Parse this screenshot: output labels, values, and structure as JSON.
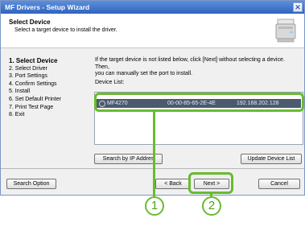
{
  "window": {
    "title": "MF Drivers - Setup Wizard",
    "close_glyph": "✕"
  },
  "header": {
    "title": "Select Device",
    "subtitle": "Select a target device to install the driver."
  },
  "steps": [
    {
      "label": "1.  Select Device",
      "active": true
    },
    {
      "label": "2.  Select Driver"
    },
    {
      "label": "3.  Port Settings"
    },
    {
      "label": "4.  Confirm Settings"
    },
    {
      "label": "5.  Install"
    },
    {
      "label": "6.  Set Default Printer"
    },
    {
      "label": "7.  Print Test Page"
    },
    {
      "label": "8.  Exit"
    }
  ],
  "main": {
    "note_line1": "If the target device is not listed below, click [Next] without selecting a device. Then,",
    "note_line2": "you can manually set the port to install.",
    "device_list_label": "Device List:",
    "devices": [
      {
        "name": "MF4270",
        "mac": "00-00-85-65-2E-4E",
        "ip": "192.168.202.128"
      }
    ],
    "search_ip_button": "Search by IP Addres",
    "update_list_button": "Update Device List"
  },
  "footer": {
    "search_option_button": "Search Option",
    "back_button": "< Back",
    "next_button": "Next >",
    "cancel_button": "Cancel"
  },
  "callouts": {
    "c1": "1",
    "c2": "2"
  },
  "colors": {
    "highlight": "#69bb2f",
    "title_bar": "#2f63c0",
    "selected_row": "#4b5a6e"
  }
}
